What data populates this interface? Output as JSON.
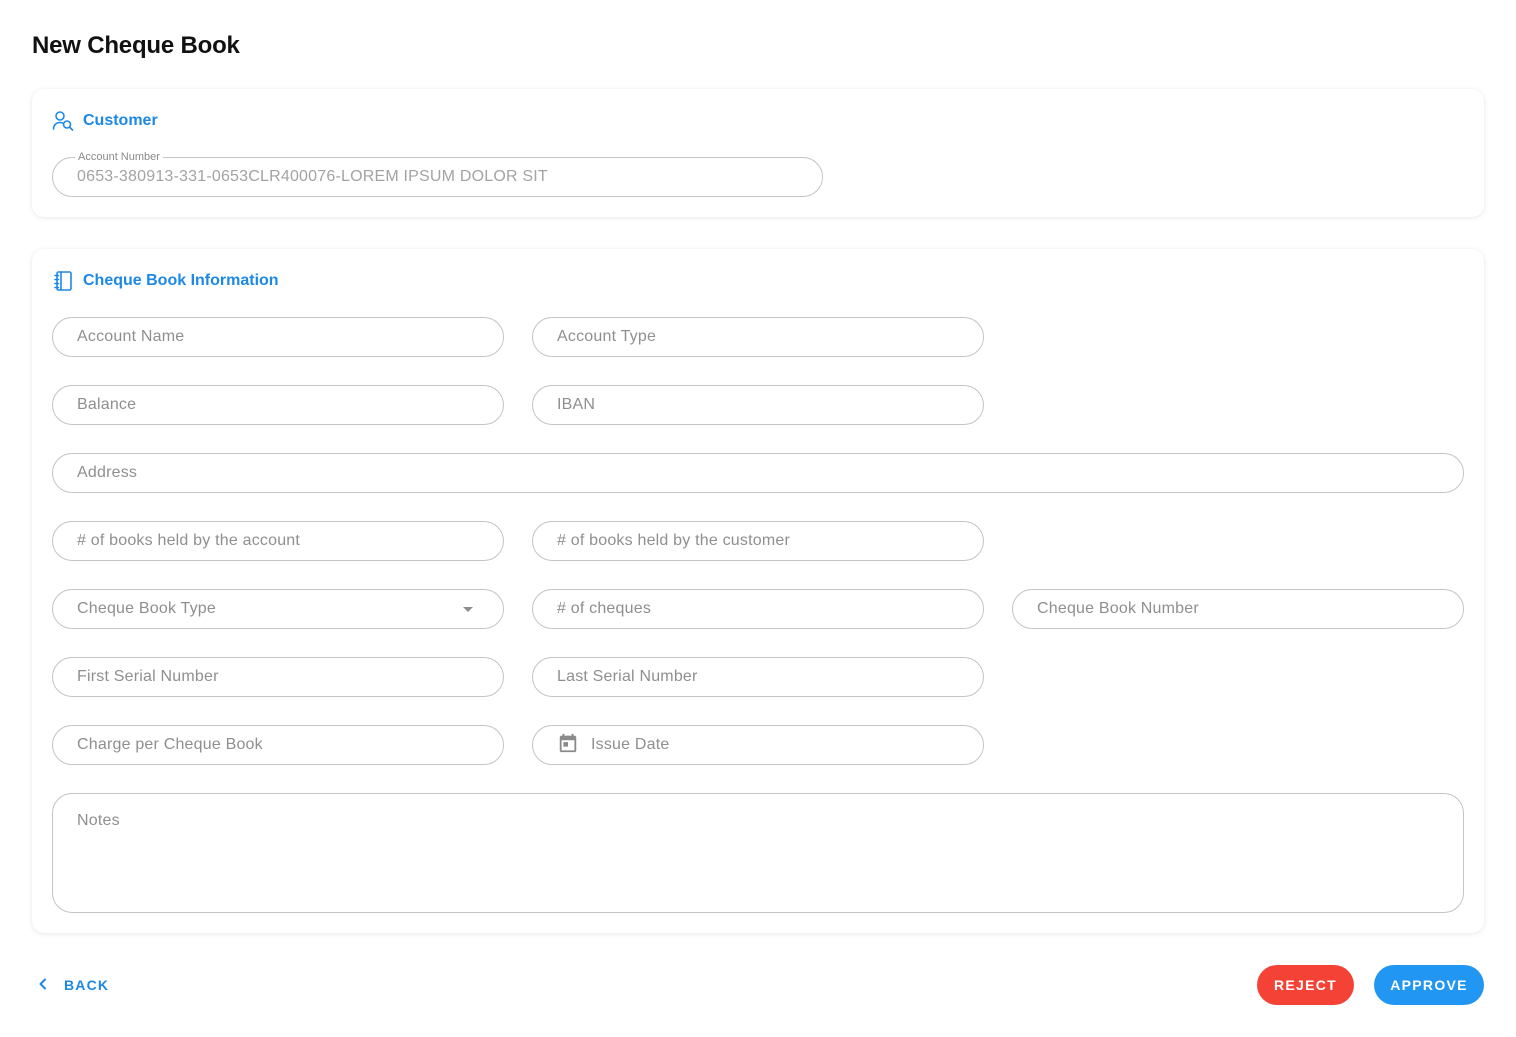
{
  "page": {
    "title": "New Cheque Book"
  },
  "customer_section": {
    "title": "Customer",
    "icon": "user-search-icon",
    "account_number": {
      "label": "Account Number",
      "value": "0653-380913-331-0653CLR400076-LOREM IPSUM DOLOR SIT"
    }
  },
  "info_section": {
    "title": "Cheque Book Information",
    "icon": "notebook-icon",
    "fields": {
      "account_name": "Account Name",
      "account_type": "Account Type",
      "balance": "Balance",
      "iban": "IBAN",
      "address": "Address",
      "books_by_account": "# of books held by the account",
      "books_by_customer": "# of books held by the customer",
      "cheque_book_type": "Cheque Book Type",
      "num_cheques": "# of cheques",
      "cheque_book_number": "Cheque Book Number",
      "first_serial": "First Serial Number",
      "last_serial": "Last Serial Number",
      "charge": "Charge per Cheque Book",
      "issue_date": "Issue Date",
      "notes": "Notes"
    }
  },
  "actions": {
    "back": "BACK",
    "reject": "REJECT",
    "approve": "APPROVE"
  },
  "colors": {
    "accent": "#1e88e5",
    "reject": "#f44336",
    "approve": "#2196f3",
    "border": "#c4c4c4"
  }
}
